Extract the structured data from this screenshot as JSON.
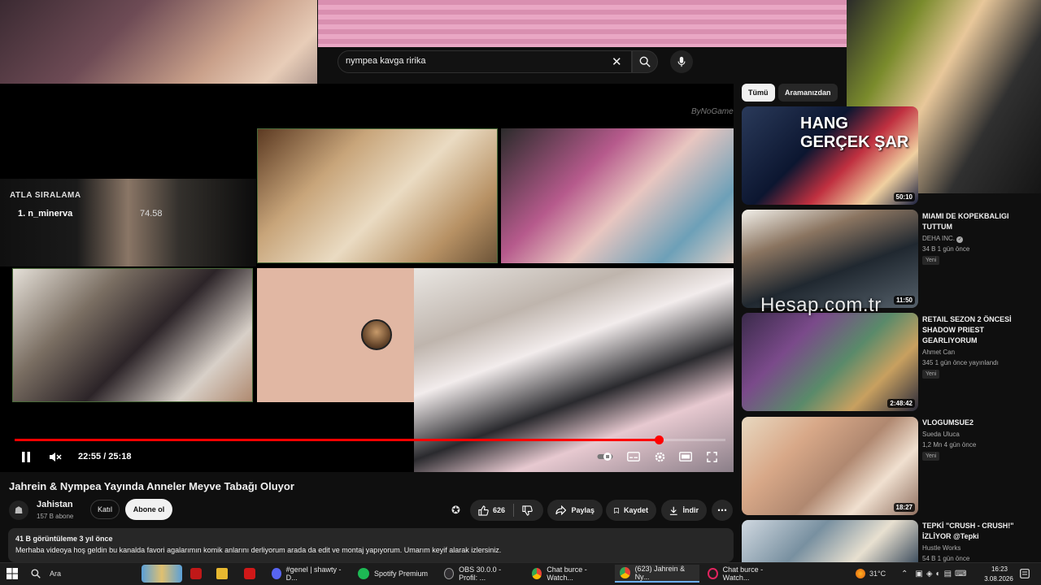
{
  "search": {
    "query": "nympea kavga ririka"
  },
  "stream": {
    "rank_title": "ATLA SIRALAMA",
    "rank_entry": "1.  n_minerva",
    "rank_score": "74.58",
    "watermark": "ByNoGame"
  },
  "player": {
    "time": "22:55 / 25:18",
    "progress": 0.906
  },
  "video": {
    "title": "Jahrein & Nympea Yayında Anneler Meyve Tabağı Oluyor",
    "channel_name": "Jahistan",
    "channel_subs": "157 B abone",
    "join_label": "Katıl",
    "subscribe_label": "Abone ol",
    "likes": "626",
    "share_label": "Paylaş",
    "save_label": "Kaydet",
    "download_label": "İndir",
    "views_date": "41 B görüntüleme  3 yıl önce",
    "description": "Merhaba videoya hoş geldin bu kanalda favori agalarımın komik anlarını derliyorum arada da edit ve montaj yapıyorum. Umarım keyif alarak izlersiniz."
  },
  "sidebar": {
    "chip_all": "Tümü",
    "chip_search": "Aramanızdan",
    "watermark": "Hesap.com.tr",
    "items": [
      {
        "duration": "50:10",
        "title": "",
        "channel": "",
        "meta": "",
        "badge": "",
        "thumb_text": "HANG GERÇEK ŞAR"
      },
      {
        "duration": "11:50",
        "title": "MIAMI DE KOPEKBALIGI TUTTUM",
        "channel": "DEHA INC.",
        "meta": "34 B  1 gün önce",
        "badge": "Yeni"
      },
      {
        "duration": "2:48:42",
        "title": "RETAIL SEZON 2 ÖNCESİ SHADOW PRIEST GEARLIYORUM",
        "channel": "Ahmet Can",
        "meta": "345  1 gün önce yayınlandı",
        "badge": "Yeni"
      },
      {
        "duration": "18:27",
        "title": "VLOGUMSUE2",
        "channel": "Sueda Uluca",
        "meta": "1,2 Mn  4 gün önce",
        "badge": "Yeni"
      },
      {
        "duration": "",
        "title": "TEPKİ \"CRUSH - CRUSH!\" İZLİYOR @Tepki",
        "channel": "Hustle Works",
        "meta": "54 B  1 gün önce",
        "badge": ""
      }
    ]
  },
  "taskbar": {
    "search_label": "Ara",
    "apps": [
      {
        "label": "#genel | shawty - D...",
        "color": "#5865f2"
      },
      {
        "label": "Spotify Premium",
        "color": "#1db954"
      },
      {
        "label": "OBS 30.0.0 - Profil: ...",
        "color": "#302e31"
      },
      {
        "label": "Chat burce - Watch...",
        "color": "#4285f4"
      },
      {
        "label": "(623) Jahrein & Ny...",
        "color": "#4285f4"
      },
      {
        "label": "Chat burce - Watch...",
        "color": "#e0245e"
      }
    ],
    "temperature": "31°C",
    "time": "16:23",
    "date": "3.08.2026"
  },
  "colors": {
    "accent": "#ff0000",
    "background": "#0f0f0f",
    "chip_bg": "#272727"
  }
}
